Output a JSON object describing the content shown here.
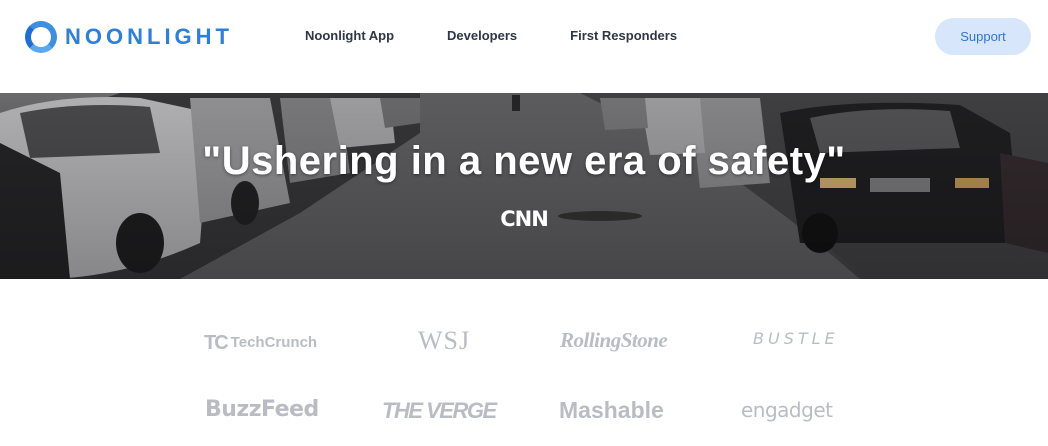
{
  "header": {
    "brand": "NOONLIGHT",
    "nav": [
      "Noonlight App",
      "Developers",
      "First Responders"
    ],
    "support_label": "Support",
    "colors": {
      "brand": "#2e7fd6",
      "support_bg": "#d7e6fb",
      "nav_text": "#2d3748"
    }
  },
  "hero": {
    "quote": "\"Ushering in a new era of safety\"",
    "source": "CNN"
  },
  "press": {
    "logos": [
      "TechCrunch",
      "WSJ",
      "RollingStone",
      "BUSTLE",
      "BuzzFeed",
      "THE VERGE",
      "Mashable",
      "engadget"
    ],
    "techcrunch_mark": "TC",
    "logo_color": "#b9bdc3"
  }
}
